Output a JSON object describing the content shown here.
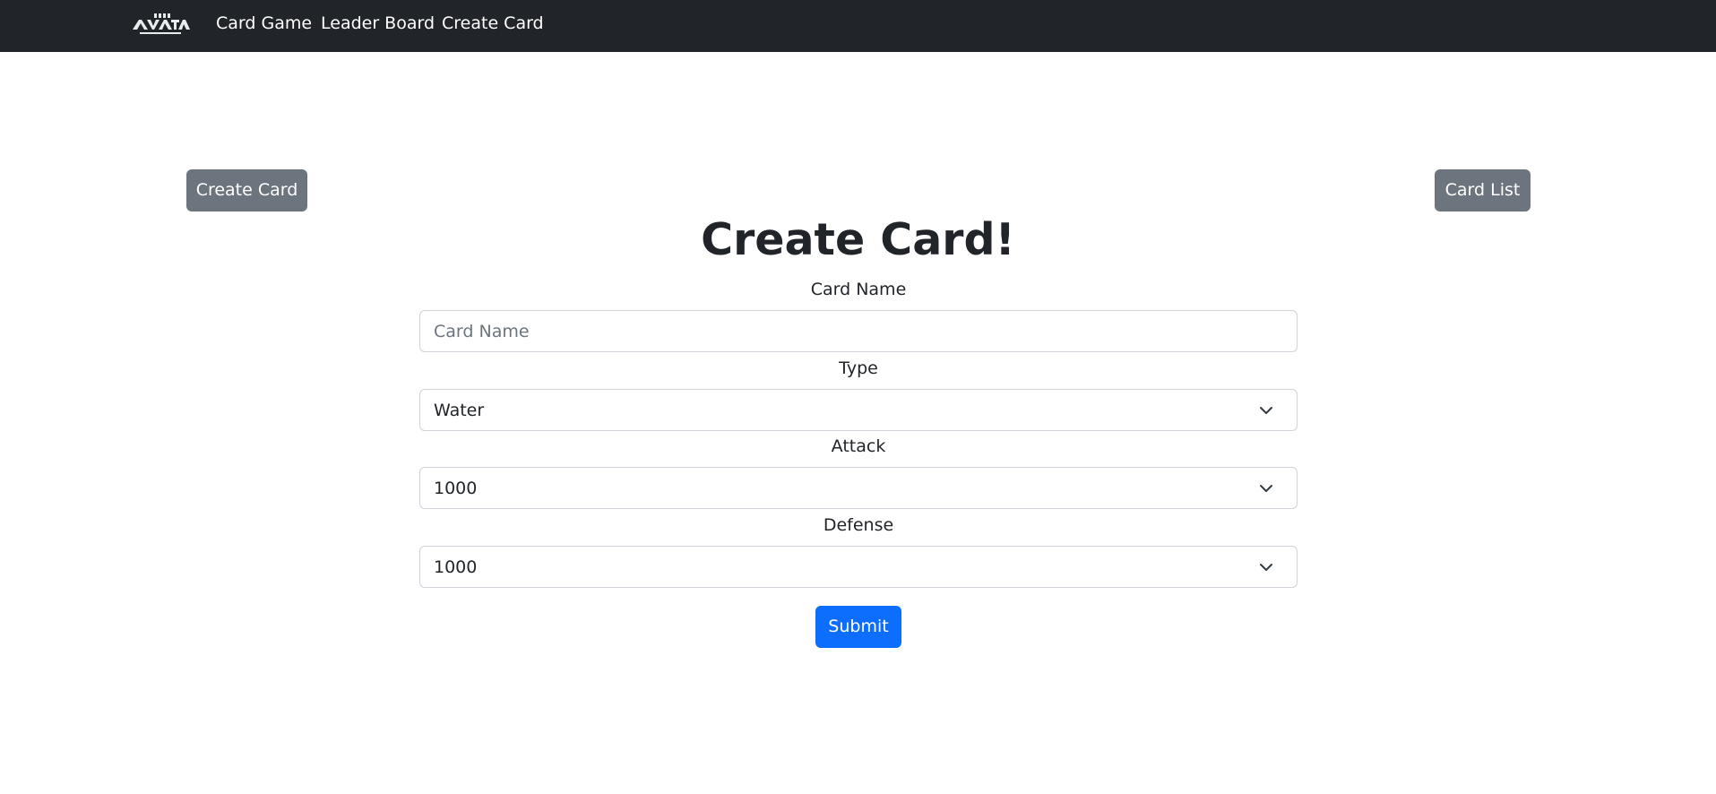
{
  "navbar": {
    "logo_icon": "avatar-logo-icon",
    "links": [
      {
        "label": "Card Game"
      },
      {
        "label": "Leader Board"
      },
      {
        "label": "Create Card"
      }
    ]
  },
  "actions": {
    "create_card_label": "Create Card",
    "card_list_label": "Card List"
  },
  "page": {
    "title": "Create Card!"
  },
  "form": {
    "card_name": {
      "label": "Card Name",
      "value": "",
      "placeholder": "Card Name"
    },
    "type": {
      "label": "Type",
      "selected": "Water"
    },
    "attack": {
      "label": "Attack",
      "selected": "1000"
    },
    "defense": {
      "label": "Defense",
      "selected": "1000"
    },
    "submit_label": "Submit"
  },
  "colors": {
    "navbar_bg": "#212529",
    "secondary_button": "#6c757d",
    "primary_button": "#0d6efd"
  }
}
